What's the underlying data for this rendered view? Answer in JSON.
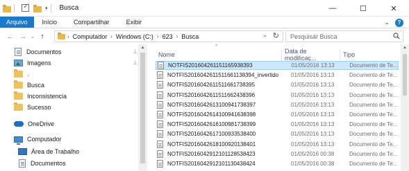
{
  "window": {
    "title": "Busca",
    "quick_access_dropdown": "▾",
    "controls": {
      "minimize": "—",
      "maximize": "☐",
      "close": "✕"
    }
  },
  "ribbon": {
    "tabs": [
      {
        "label": "Arquivo"
      },
      {
        "label": "Início"
      },
      {
        "label": "Compartilhar"
      },
      {
        "label": "Exibir"
      }
    ],
    "expand_glyph": "⌄",
    "help_glyph": "?"
  },
  "address": {
    "back_glyph": "←",
    "forward_glyph": "→",
    "recent_glyph": "⌄",
    "up_glyph": "↑",
    "breadcrumbs": [
      "Computador",
      "Windows (C:)",
      "623",
      "Busca"
    ],
    "separator": "›",
    "dropdown_glyph": "⌄",
    "refresh_glyph": "↻"
  },
  "search": {
    "placeholder": "Pesquisar Busca"
  },
  "nav_pane": {
    "items": [
      {
        "label": "Documentos",
        "icon": "documents-icon",
        "pinned": true
      },
      {
        "label": "Imagens",
        "icon": "pictures-icon",
        "pinned": true
      },
      {
        "label": ".",
        "icon": "folder-icon",
        "pinned": false
      },
      {
        "label": "Busca",
        "icon": "folder-icon",
        "pinned": false
      },
      {
        "label": "Inconsistencia",
        "icon": "folder-icon",
        "pinned": false
      },
      {
        "label": "Sucesso",
        "icon": "folder-icon",
        "pinned": false
      },
      {
        "label": "OneDrive",
        "icon": "onedrive-icon",
        "pinned": false
      },
      {
        "label": "Computador",
        "icon": "computer-icon",
        "pinned": false
      },
      {
        "label": "Área de Trabalho",
        "icon": "desktop-icon",
        "pinned": false
      },
      {
        "label": "Documentos",
        "icon": "documents-icon",
        "pinned": false
      }
    ],
    "pin_glyph": "⊥"
  },
  "file_list": {
    "columns": {
      "name": "Nome",
      "date": "Data de modificaç...",
      "type": "Tipo"
    },
    "sort_glyph": "^",
    "files": [
      {
        "name": "NOTFIS20160426115116593839​3",
        "date": "01/05/2016 13:13",
        "type": "Documento de Te...",
        "selected": true
      },
      {
        "name": "NOTFIS20160426115116611383​94_invertido",
        "date": "01/05/2016 13:13",
        "type": "Documento de Te...",
        "selected": false
      },
      {
        "name": "NOTFIS20160426115116617383​95",
        "date": "01/05/2016 13:13",
        "type": "Documento de Te...",
        "selected": false
      },
      {
        "name": "NOTFIS20160426115116624383​96",
        "date": "01/05/2016 13:13",
        "type": "Documento de Te...",
        "selected": false
      },
      {
        "name": "NOTFIS20160426131009417383​97",
        "date": "01/05/2016 13:13",
        "type": "Documento de Te...",
        "selected": false
      },
      {
        "name": "NOTFIS20160426141009416383​98",
        "date": "01/05/2016 13:13",
        "type": "Documento de Te...",
        "selected": false
      },
      {
        "name": "NOTFIS20160426161009817383​99",
        "date": "01/05/2016 13:13",
        "type": "Documento de Te...",
        "selected": false
      },
      {
        "name": "NOTFIS20160426171009335384​00",
        "date": "01/05/2016 13:13",
        "type": "Documento de Te...",
        "selected": false
      },
      {
        "name": "NOTFIS20160426181009201384​01",
        "date": "01/05/2016 13:13",
        "type": "Documento de Te...",
        "selected": false
      },
      {
        "name": "NOTFIS20160429121011285384​23",
        "date": "01/05/2016 00:38",
        "type": "Documento de Te...",
        "selected": false
      },
      {
        "name": "NOTFIS20160429121011304384​24",
        "date": "01/05/2016 00:38",
        "type": "Documento de Te...",
        "selected": false
      }
    ]
  },
  "colors": {
    "accent": "#1979ca",
    "selection_bg": "#cce8ff",
    "selection_border": "#99d1ff",
    "folder": "#f0c35a"
  }
}
